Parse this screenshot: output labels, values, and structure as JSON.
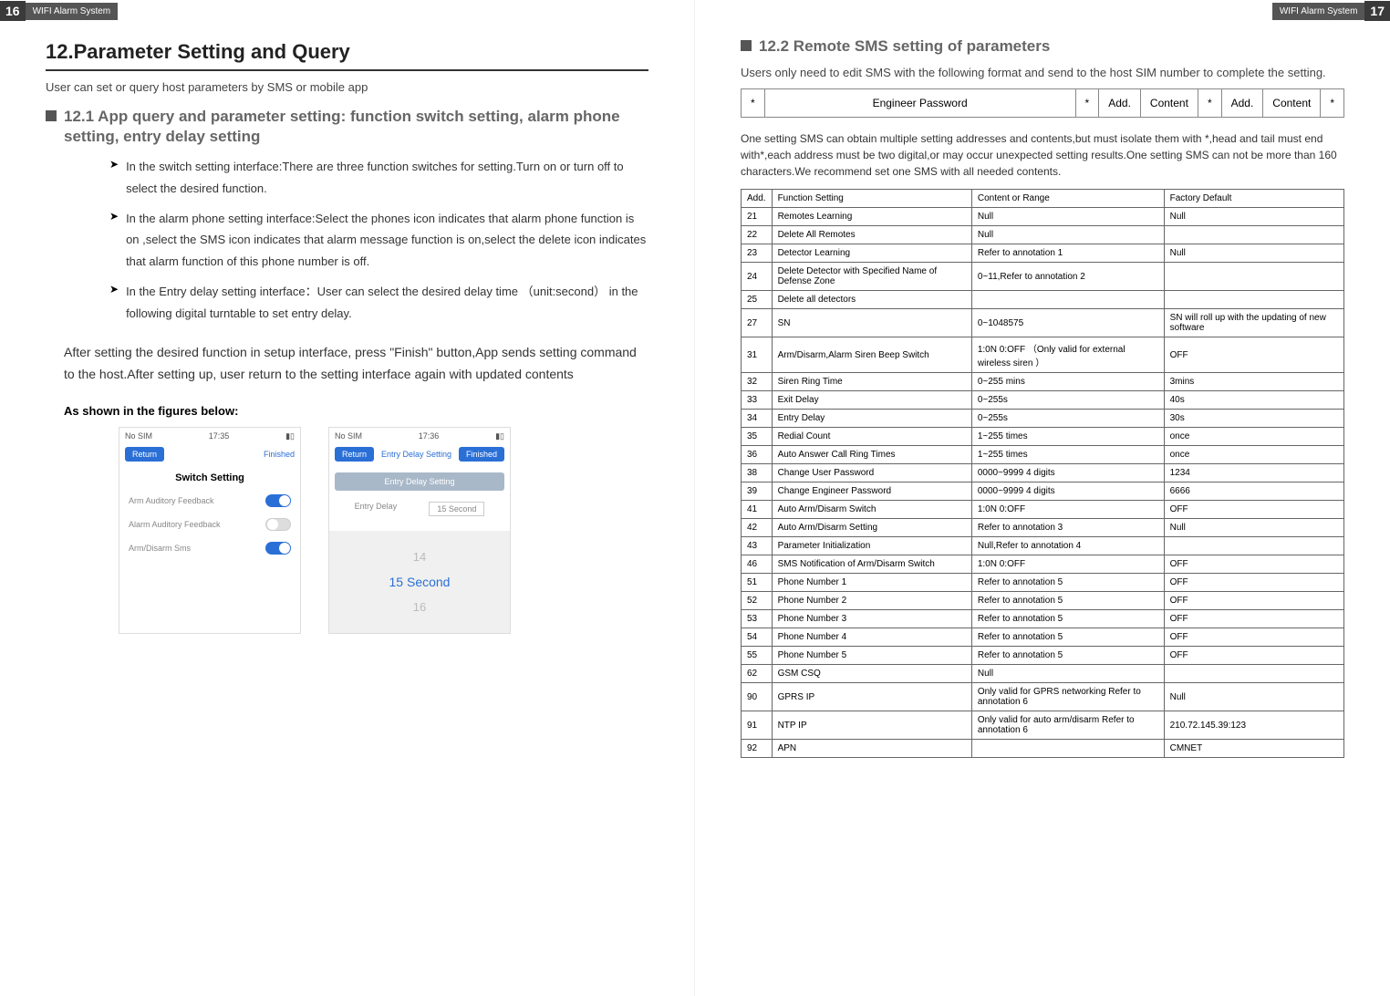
{
  "leftPage": {
    "pageNum": "16",
    "sysLabel": "WIFI Alarm System",
    "title": "12.Parameter Setting and Query",
    "intro": "User can set or query host parameters by SMS or mobile app",
    "sub1": "12.1 App query and parameter setting: function switch setting, alarm phone setting, entry delay setting",
    "b1": "In the switch setting interface:There are three function switches for setting.Turn on or turn off to select the desired function.",
    "b2": "In the alarm phone setting interface:Select the phones icon indicates that alarm phone function is on ,select the SMS icon indicates that alarm message function is on,select the delete icon indicates that alarm function of this phone number is off.",
    "b3": "In the Entry delay setting interface：User can select the desired delay time （unit:second） in the following digital turntable to set entry delay.",
    "para": "After setting the desired function in setup interface, press \"Finish\" button,App sends setting command to the host.After setting up, user return to the setting interface again with updated contents",
    "figcap": "As shown in the figures below:",
    "phone1": {
      "carrier": "No SIM",
      "time": "17:35",
      "return": "Return",
      "finish": "Finished",
      "title": "Switch Setting",
      "r1": "Arm Auditory Feedback",
      "r2": "Alarm Auditory Feedback",
      "r3": "Arm/Disarm Sms"
    },
    "phone2": {
      "carrier": "No SIM",
      "time": "17:36",
      "return": "Return",
      "finish": "Finished",
      "title": "Entry Delay Setting",
      "entrySetting": "Entry Delay Setting",
      "entryDelay": "Entry Delay",
      "entryVal": "15 Second",
      "p14": "14",
      "p15": "15 Second",
      "p16": "16"
    }
  },
  "rightPage": {
    "pageNum": "17",
    "sysLabel": "WIFI Alarm System",
    "sub": "12.2 Remote SMS setting of parameters",
    "intro": "Users only need to edit SMS with the following format and send to the host SIM number to complete the setting.",
    "fmt": {
      "star": "*",
      "ep": "Engineer Password",
      "add": "Add.",
      "content": "Content"
    },
    "note": "One setting SMS can obtain multiple setting addresses and contents,but must isolate them with *,head and tail must end with*,each address must be two digital,or may occur unexpected setting results.One setting SMS can not be more than 160 characters.We recommend set one SMS with all needed contents.",
    "hdr": {
      "add": "Add.",
      "fs": "Function Setting",
      "cr": "Content or Range",
      "fd": "Factory Default"
    },
    "rows": [
      {
        "a": "21",
        "f": "Remotes Learning",
        "c": "Null",
        "d": "Null"
      },
      {
        "a": "22",
        "f": "Delete All Remotes",
        "c": "Null",
        "d": ""
      },
      {
        "a": "23",
        "f": "Detector Learning",
        "c": "Refer to annotation 1",
        "d": "Null"
      },
      {
        "a": "24",
        "f": "Delete Detector with Specified Name of Defense Zone",
        "c": "0~11,Refer to annotation 2",
        "d": ""
      },
      {
        "a": "25",
        "f": "Delete all detectors",
        "c": "",
        "d": ""
      },
      {
        "a": "27",
        "f": "SN",
        "c": "0~1048575",
        "d": "SN will roll up with the updating of new software"
      },
      {
        "a": "31",
        "f": "Arm/Disarm,Alarm Siren Beep Switch",
        "c": "1:0N 0:OFF （Only valid for external wireless siren ）",
        "d": "OFF"
      },
      {
        "a": "32",
        "f": "Siren Ring Time",
        "c": "0~255 mins",
        "d": "3mins"
      },
      {
        "a": "33",
        "f": "Exit Delay",
        "c": "0~255s",
        "d": "40s"
      },
      {
        "a": "34",
        "f": "Entry Delay",
        "c": "0~255s",
        "d": "30s"
      },
      {
        "a": "35",
        "f": "Redial Count",
        "c": "1~255 times",
        "d": "once"
      },
      {
        "a": "36",
        "f": "Auto Answer Call Ring Times",
        "c": "1~255 times",
        "d": "once"
      },
      {
        "a": "38",
        "f": "Change User Password",
        "c": "0000~9999    4 digits",
        "d": "1234"
      },
      {
        "a": "39",
        "f": "Change Engineer Password",
        "c": "0000~9999    4 digits",
        "d": "6666"
      },
      {
        "a": "41",
        "f": "Auto Arm/Disarm Switch",
        "c": "1:0N 0:OFF",
        "d": "OFF"
      },
      {
        "a": "42",
        "f": "Auto Arm/Disarm Setting",
        "c": "Refer to annotation 3",
        "d": "Null"
      },
      {
        "a": "43",
        "f": "Parameter Initialization",
        "c": "Null,Refer to annotation 4",
        "d": ""
      },
      {
        "a": "46",
        "f": "SMS Notification of Arm/Disarm Switch",
        "c": "1:0N 0:OFF",
        "d": "OFF"
      },
      {
        "a": "51",
        "f": "Phone Number 1",
        "c": "Refer to annotation 5",
        "d": "OFF"
      },
      {
        "a": "52",
        "f": "Phone Number 2",
        "c": "Refer to annotation 5",
        "d": "OFF"
      },
      {
        "a": "53",
        "f": "Phone Number 3",
        "c": "Refer to annotation 5",
        "d": "OFF"
      },
      {
        "a": "54",
        "f": "Phone Number 4",
        "c": "Refer to annotation 5",
        "d": "OFF"
      },
      {
        "a": "55",
        "f": "Phone Number 5",
        "c": "Refer to annotation 5",
        "d": "OFF"
      },
      {
        "a": "62",
        "f": "GSM CSQ",
        "c": "Null",
        "d": ""
      },
      {
        "a": "90",
        "f": "GPRS IP",
        "c": "Only valid for GPRS networking Refer to annotation 6",
        "d": "Null"
      },
      {
        "a": "91",
        "f": "NTP IP",
        "c": "Only valid for auto arm/disarm Refer to annotation 6",
        "d": "210.72.145.39:123"
      },
      {
        "a": "92",
        "f": "APN",
        "c": "",
        "d": "CMNET"
      }
    ]
  }
}
